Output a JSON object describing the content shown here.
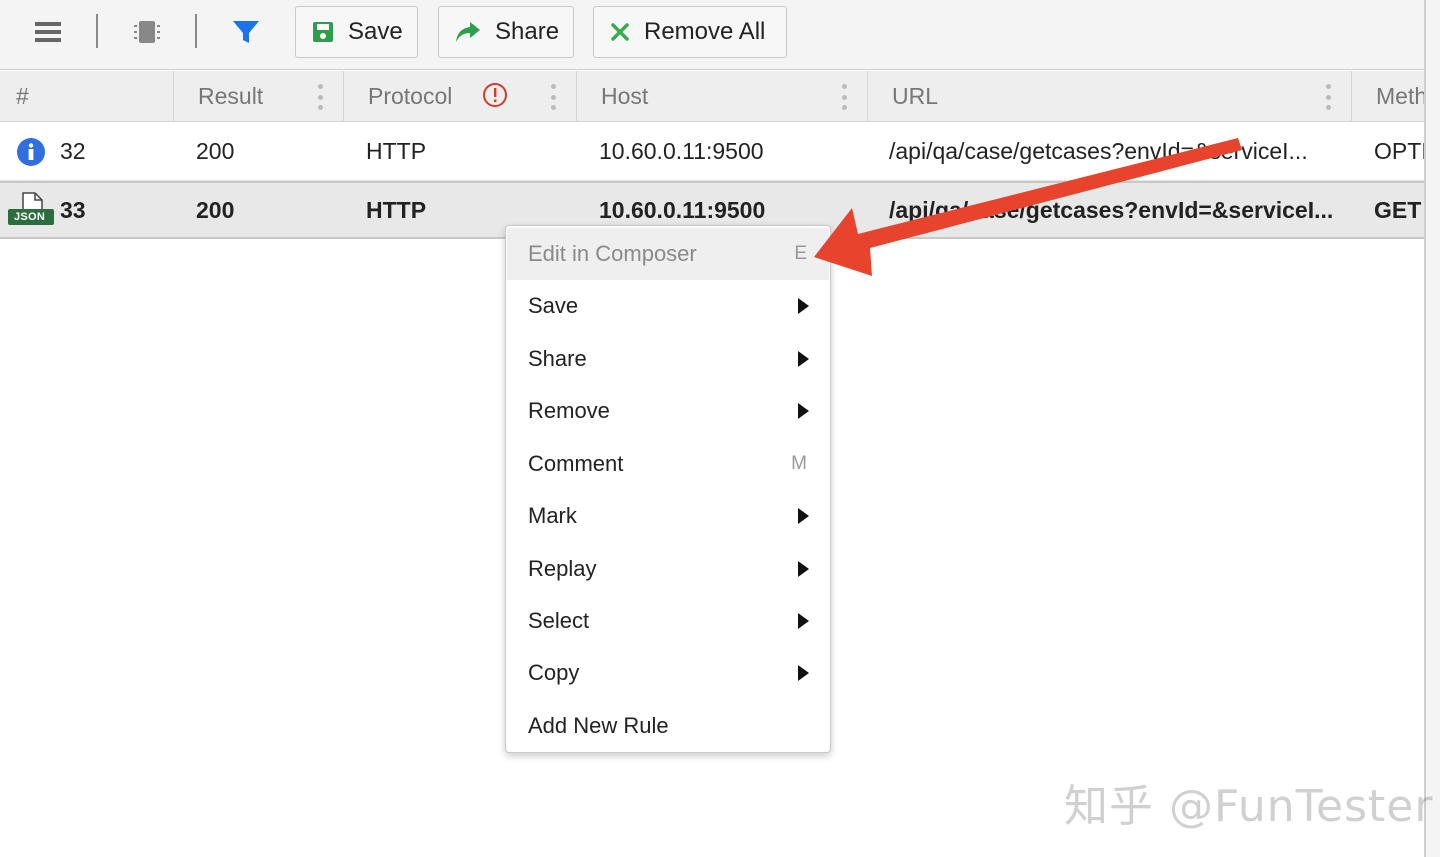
{
  "toolbar": {
    "icons": [
      "menu-icon",
      "decode-icon",
      "filter-icon"
    ],
    "buttons": [
      {
        "label": "Save",
        "icon": "save-icon"
      },
      {
        "label": "Share",
        "icon": "share-icon"
      },
      {
        "label": "Remove All",
        "icon": "close-icon"
      }
    ]
  },
  "table": {
    "columns": [
      "#",
      "Result",
      "Protocol",
      "Host",
      "URL",
      "Meth"
    ],
    "rows": [
      {
        "num": "32",
        "icon": "info-icon",
        "result": "200",
        "protocol": "HTTP",
        "host": "10.60.0.11:9500",
        "url": "/api/qa/case/getcases?envId=&serviceI...",
        "method": "OPTI"
      },
      {
        "num": "33",
        "icon": "json-file-icon",
        "icon_text": "JSON",
        "result": "200",
        "protocol": "HTTP",
        "host": "10.60.0.11:9500",
        "url": "/api/qa/case/getcases?envId=&serviceI...",
        "method": "GET"
      }
    ]
  },
  "context_menu": {
    "items": [
      {
        "label": "Edit in Composer",
        "shortcut": "E",
        "disabled": true
      },
      {
        "label": "Save",
        "submenu": true
      },
      {
        "label": "Share",
        "submenu": true
      },
      {
        "label": "Remove",
        "submenu": true
      },
      {
        "label": "Comment",
        "shortcut": "M"
      },
      {
        "label": "Mark",
        "submenu": true
      },
      {
        "label": "Replay",
        "submenu": true
      },
      {
        "label": "Select",
        "submenu": true
      },
      {
        "label": "Copy",
        "submenu": true
      },
      {
        "label": "Add New Rule"
      }
    ]
  },
  "annotation": {
    "type": "arrow",
    "color": "#e8432d"
  },
  "watermark": "知乎 @FunTester",
  "colors": {
    "accent_blue": "#1a73e8",
    "save_green": "#2e9e4a",
    "close_green": "#3aaa4f",
    "alert_red": "#d33b2c",
    "json_green": "#2b6d3d"
  }
}
